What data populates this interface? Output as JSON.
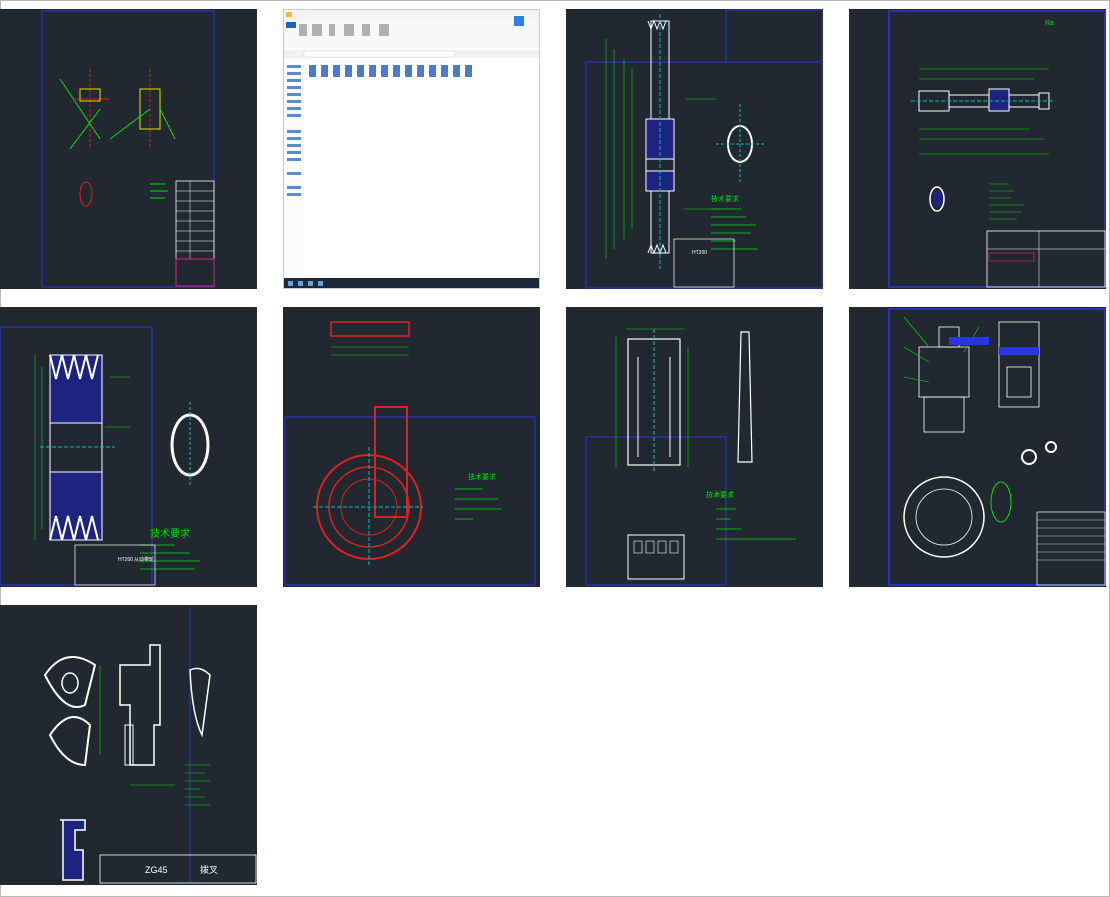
{
  "thumbnails": [
    {
      "id": "t1",
      "kind": "cad-assembly-sheet"
    },
    {
      "id": "t2",
      "kind": "file-explorer-window"
    },
    {
      "id": "t3",
      "kind": "cad-pulley-drawing",
      "note_title": "技术要求",
      "title_block_text": "HT200"
    },
    {
      "id": "t4",
      "kind": "cad-shaft-drawing",
      "roughness_mark": "Ra"
    },
    {
      "id": "t5",
      "kind": "cad-pulley-section",
      "note_title": "技术要求",
      "title_block_text": "HT200",
      "title_block_label": "从动带轮"
    },
    {
      "id": "t6",
      "kind": "cad-gear-housing",
      "note_title": "技术要求"
    },
    {
      "id": "t7",
      "kind": "cad-part-views",
      "note_title": "技术要求"
    },
    {
      "id": "t8",
      "kind": "cad-assembly-multi"
    },
    {
      "id": "t9",
      "kind": "cad-fork-part",
      "title_block_text": "ZG45",
      "title_block_label": "拨叉"
    }
  ],
  "colors": {
    "cad_bg": "#212830",
    "white": "#ffffff",
    "green": "#00e000",
    "blue": "#1c2ad8",
    "navy": "#1c2480",
    "red": "#e02020",
    "cyan": "#20d0d0",
    "yellow": "#e8e000"
  }
}
